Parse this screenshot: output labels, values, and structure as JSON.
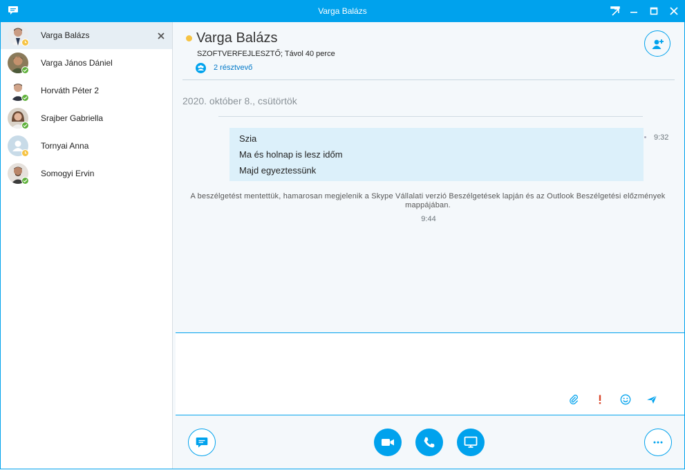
{
  "window": {
    "title": "Varga Balázs"
  },
  "contacts": [
    {
      "name": "Varga Balázs",
      "presence": "away",
      "selected": true
    },
    {
      "name": "Varga János Dániel",
      "presence": "available",
      "selected": false
    },
    {
      "name": "Horváth Péter 2",
      "presence": "available",
      "selected": false
    },
    {
      "name": "Srajber Gabriella",
      "presence": "available",
      "selected": false
    },
    {
      "name": "Tornyai Anna",
      "presence": "away",
      "selected": false
    },
    {
      "name": "Somogyi Ervin",
      "presence": "available",
      "selected": false
    }
  ],
  "conversation": {
    "name": "Varga Balázs",
    "subtitle": "SZOFTVERFEJLESZTŐ;  Távol 40 perce",
    "participants": "2 résztvevő",
    "date": "2020. október 8., csütörtök",
    "messages": [
      "Szia",
      "Ma és holnap is lesz időm",
      "Majd egyeztessünk"
    ],
    "message_time": "9:32",
    "system_note": "A beszélgetést mentettük, hamarosan megjelenik a Skype Vállalati verzió Beszélgetések lapján és az Outlook Beszélgetési előzmények mappájában.",
    "system_time": "9:44"
  },
  "colors": {
    "accent": "#00a2ed",
    "available": "#5fb13b",
    "away": "#f6c343",
    "bubble": "#dcf0fa",
    "important": "#d9472b"
  },
  "icons": {
    "title": [
      "chat-bubble-icon",
      "popout-icon",
      "minimize-icon",
      "maximize-icon",
      "close-icon"
    ],
    "compose": [
      "paperclip-icon",
      "exclamation-icon",
      "smiley-icon",
      "send-icon"
    ],
    "bottom": [
      "chat-icon",
      "video-icon",
      "phone-icon",
      "screen-share-icon",
      "more-icon"
    ]
  }
}
